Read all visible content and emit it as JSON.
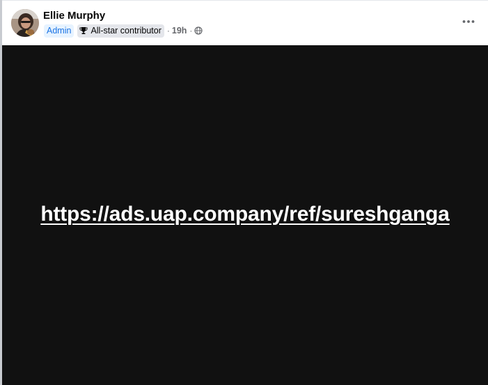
{
  "post": {
    "author": {
      "name": "Ellie Murphy",
      "avatar_icon": "user-avatar-photo"
    },
    "badges": {
      "admin_label": "Admin",
      "contributor_label": "All-star contributor",
      "contributor_icon": "trophy-icon"
    },
    "meta": {
      "separator": "·",
      "timestamp": "19h",
      "audience_icon": "globe-icon"
    },
    "menu_icon": "more-options-icon",
    "media": {
      "link_text": "https://ads.uap.company/ref/sureshganga",
      "background_color": "#111111",
      "text_color": "#ffffff"
    }
  },
  "colors": {
    "admin_badge_bg": "#e7f3ff",
    "admin_badge_text": "#1b74e4",
    "contributor_badge_bg": "#e4e6eb",
    "secondary_text": "#65676b"
  }
}
